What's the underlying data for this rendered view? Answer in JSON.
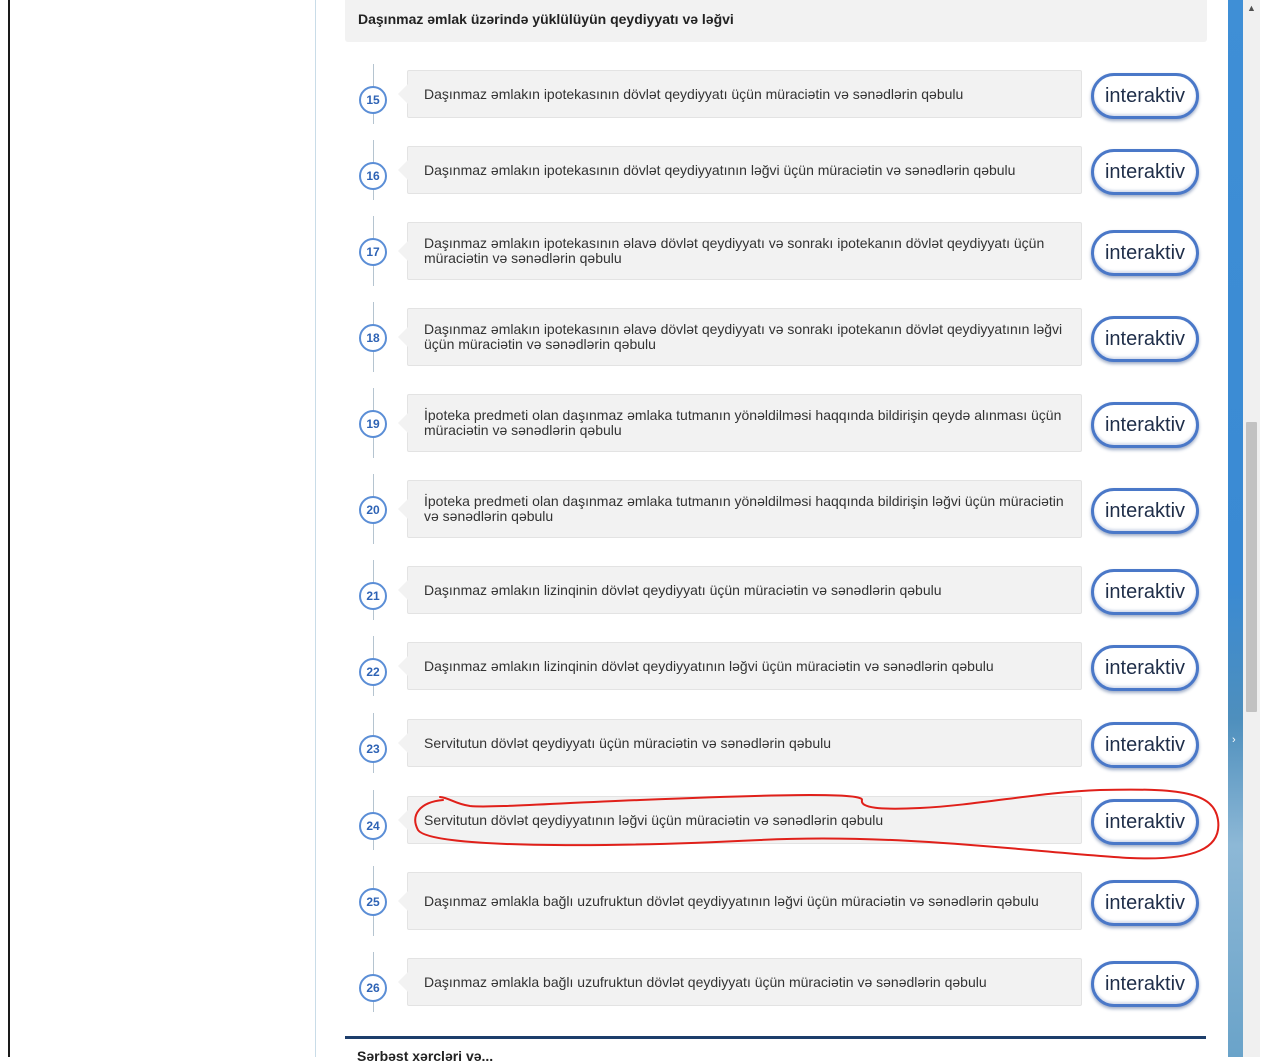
{
  "section": {
    "title": "Daşınmaz əmlak üzərində yüklülüyün qeydiyyatı və ləğvi"
  },
  "services": [
    {
      "number": "15",
      "text": "Daşınmaz əmlakın ipotekasının dövlət qeydiyyatı üçün müraciətin və sənədlərin qəbulu",
      "button": "interaktiv"
    },
    {
      "number": "16",
      "text": "Daşınmaz əmlakın ipotekasının dövlət qeydiyyatının ləğvi üçün müraciətin və sənədlərin qəbulu",
      "button": "interaktiv"
    },
    {
      "number": "17",
      "text": "Daşınmaz əmlakın ipotekasının əlavə dövlət qeydiyyatı və sonrakı ipotekanın dövlət qeydiyyatı üçün müraciətin və sənədlərin qəbulu",
      "button": "interaktiv"
    },
    {
      "number": "18",
      "text": "Daşınmaz əmlakın ipotekasının əlavə dövlət qeydiyyatı və sonrakı ipotekanın dövlət qeydiyyatının ləğvi üçün müraciətin və sənədlərin qəbulu",
      "button": "interaktiv"
    },
    {
      "number": "19",
      "text": "İpoteka predmeti olan daşınmaz əmlaka tutmanın yönəldilməsi haqqında bildirişin qeydə alınması üçün müraciətin və sənədlərin qəbulu",
      "button": "interaktiv"
    },
    {
      "number": "20",
      "text": "İpoteka predmeti olan daşınmaz əmlaka tutmanın yönəldilməsi haqqında bildirişin ləğvi üçün müraciətin və sənədlərin qəbulu",
      "button": "interaktiv"
    },
    {
      "number": "21",
      "text": "Daşınmaz əmlakın lizinqinin dövlət qeydiyyatı üçün müraciətin və sənədlərin qəbulu",
      "button": "interaktiv"
    },
    {
      "number": "22",
      "text": "Daşınmaz əmlakın lizinqinin dövlət qeydiyyatının ləğvi üçün müraciətin və sənədlərin qəbulu",
      "button": "interaktiv"
    },
    {
      "number": "23",
      "text": "Servitutun dövlət qeydiyyatı üçün müraciətin və sənədlərin qəbulu",
      "button": "interaktiv"
    },
    {
      "number": "24",
      "text": "Servitutun dövlət qeydiyyatının ləğvi üçün müraciətin və sənədlərin qəbulu",
      "button": "interaktiv"
    },
    {
      "number": "25",
      "text": "Daşınmaz əmlakla bağlı uzufruktun dövlət qeydiyyatının ləğvi üçün müraciətin və sənədlərin qəbulu",
      "button": "interaktiv"
    },
    {
      "number": "26",
      "text": "Daşınmaz əmlakla bağlı uzufruktun dövlət qeydiyyatı üçün müraciətin və sənədlərin qəbulu",
      "button": "interaktiv"
    }
  ],
  "footer": {
    "title": "Sərbəst xərcləri və..."
  },
  "annotation": {
    "color": "#e0201a",
    "highlighted_item": "24"
  },
  "colors": {
    "accent_blue": "#4a78c8",
    "card_bg": "#f2f2f2",
    "footer_bar": "#1d3e6b"
  }
}
